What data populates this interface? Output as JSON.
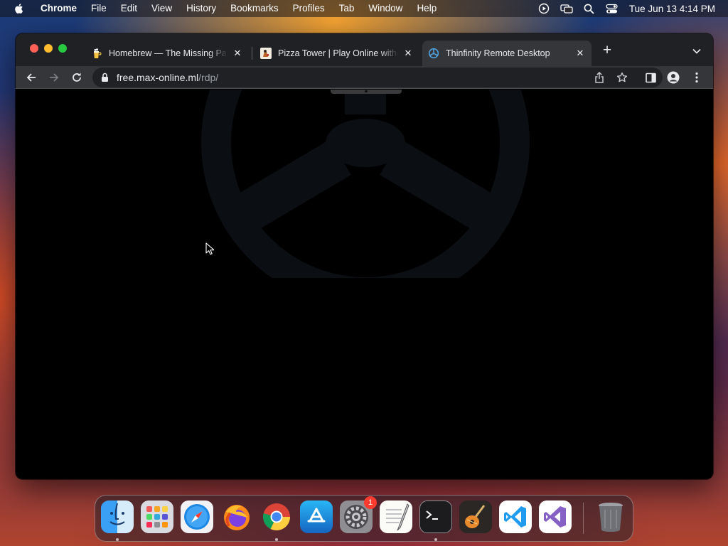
{
  "menubar": {
    "apple_icon": "apple-logo-icon",
    "app_name": "Chrome",
    "menus": [
      "File",
      "Edit",
      "View",
      "History",
      "Bookmarks",
      "Profiles",
      "Tab",
      "Window",
      "Help"
    ],
    "status_icons": [
      "screen-recording-icon",
      "screen-mirroring-icon",
      "spotlight-search-icon",
      "control-center-icon"
    ],
    "clock": "Tue Jun 13  4:14 PM"
  },
  "browser": {
    "tabs": [
      {
        "title": "Homebrew — The Missing Package Manager",
        "favicon": "homebrew-beer-icon",
        "active": false
      },
      {
        "title": "Pizza Tower | Play Online without Downloading",
        "favicon": "pizza-tower-icon",
        "active": false
      },
      {
        "title": "Thinfinity Remote Desktop",
        "favicon": "thinfinity-icon",
        "active": true
      }
    ],
    "url": {
      "host": "free.max-online.ml",
      "path": "/rdp/"
    },
    "toolbar_icons": [
      "back-arrow-icon",
      "forward-arrow-icon",
      "reload-icon",
      "share-icon",
      "bookmark-star-icon",
      "side-panel-icon",
      "profile-icon",
      "more-menu-icon"
    ]
  },
  "dock": {
    "apps": [
      {
        "name": "Finder",
        "icon": "finder-icon",
        "running": true
      },
      {
        "name": "Launchpad",
        "icon": "launchpad-icon",
        "running": false
      },
      {
        "name": "Safari",
        "icon": "safari-icon",
        "running": false
      },
      {
        "name": "Firefox",
        "icon": "firefox-icon",
        "running": false
      },
      {
        "name": "Google Chrome",
        "icon": "chrome-icon",
        "running": true
      },
      {
        "name": "App Store",
        "icon": "app-store-icon",
        "running": false
      },
      {
        "name": "System Preferences",
        "icon": "system-preferences-icon",
        "running": false,
        "badge": "1"
      },
      {
        "name": "TextEdit",
        "icon": "textedit-icon",
        "running": false
      },
      {
        "name": "Terminal",
        "icon": "terminal-icon",
        "running": true
      },
      {
        "name": "GarageBand",
        "icon": "garageband-icon",
        "running": false
      },
      {
        "name": "Visual Studio Code",
        "icon": "vscode-icon",
        "running": false
      },
      {
        "name": "Visual Studio",
        "icon": "visual-studio-icon",
        "running": false
      },
      {
        "name": "Trash",
        "icon": "trash-icon",
        "running": false
      }
    ]
  }
}
